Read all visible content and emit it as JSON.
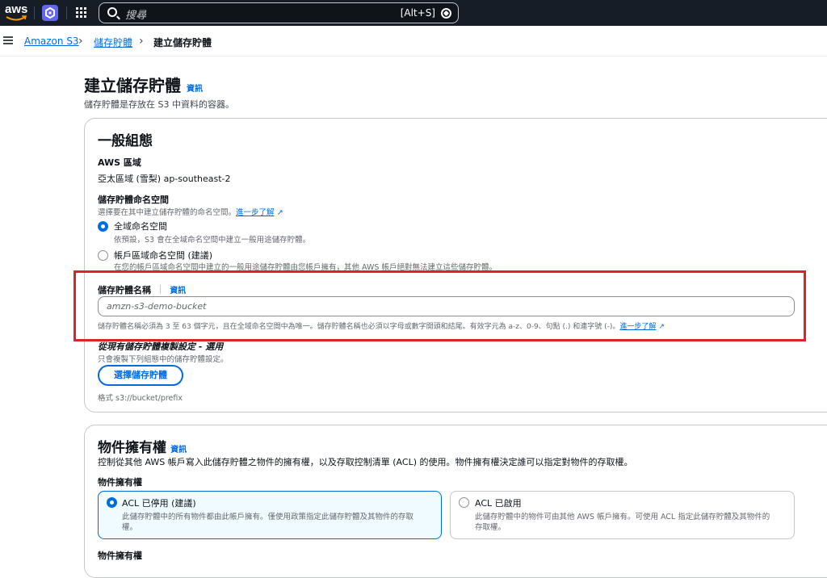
{
  "topbar": {
    "logo_text": "aws",
    "search_placeholder": "搜尋",
    "search_shortcut": "[Alt+S]"
  },
  "breadcrumbs": [
    {
      "label": "Amazon S3"
    },
    {
      "label": "儲存貯體"
    },
    {
      "label": "建立儲存貯體"
    }
  ],
  "page": {
    "title": "建立儲存貯體",
    "info": "資訊",
    "description": "儲存貯體是存放在 S3 中資料的容器。"
  },
  "general": {
    "heading": "一般組態",
    "region_label": "AWS 區域",
    "region_value": "亞太區域 (雪梨) ap-southeast-2",
    "namespace_label": "儲存貯體命名空間",
    "namespace_hint": "選擇要在其中建立儲存貯體的命名空間。",
    "learn_more": "進一步了解",
    "options": [
      {
        "label": "全域命名空間",
        "desc": "依預設，S3 會在全域命名空間中建立一般用途儲存貯體。",
        "selected": true
      },
      {
        "label": "帳戶區域命名空間 (建議)",
        "desc": "在您的帳戶區域命名空間中建立的一般用途儲存貯體由您帳戶擁有，其他 AWS 帳戶絕對無法建立這些儲存貯體。",
        "selected": false
      }
    ],
    "bucket_name_label": "儲存貯體名稱",
    "bucket_name_info": "資訊",
    "bucket_name_value": "",
    "bucket_name_placeholder": "amzn-s3-demo-bucket",
    "bucket_name_hint": "儲存貯體名稱必須為 3 至 63 個字元，且在全域命名空間中為唯一。儲存貯體名稱也必須以字母或數字開頭和結尾。有效字元為 a-z、0-9、句點 (.) 和連字號 (-)。",
    "copy_label": "從現有儲存貯體複製設定 - 選用",
    "copy_hint": "只會複製下列組態中的儲存貯體設定。",
    "choose_bucket_button": "選擇儲存貯體",
    "format_hint": "格式 s3://bucket/prefix"
  },
  "ownership": {
    "heading": "物件擁有權",
    "info": "資訊",
    "description": "控制從其他 AWS 帳戶寫入此儲存貯體之物件的擁有權，以及存取控制清單 (ACL) 的使用。物件擁有權決定誰可以指定對物件的存取權。",
    "field_label": "物件擁有權",
    "tiles": [
      {
        "label": "ACL 已停用 (建議)",
        "desc_line1": "此儲存貯體中的所有物件都由此帳戶擁有。僅使用政策指定此儲存貯體及其物件的存取",
        "desc_line2": "權。",
        "selected": true
      },
      {
        "label": "ACL 已啟用",
        "desc_line1": "此儲存貯體中的物件可由其他 AWS 帳戶擁有。可使用 ACL 指定此儲存貯體及其物件的",
        "desc_line2": "存取權。",
        "selected": false
      }
    ],
    "footer_label": "物件擁有權"
  },
  "colors": {
    "topbar": "#161d26",
    "link": "#006ce0",
    "highlight": "#d9232e"
  }
}
